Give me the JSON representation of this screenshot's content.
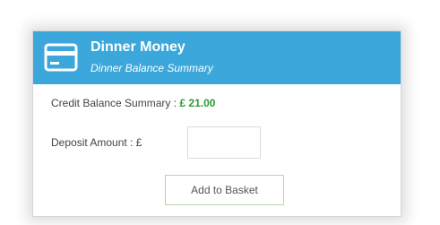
{
  "header": {
    "title": "Dinner Money",
    "subtitle": "Dinner Balance Summary",
    "icon": "credit-card-icon",
    "background_color": "#3ba7da"
  },
  "credit": {
    "label": "Credit Balance Summary :",
    "amount": "£ 21.00",
    "amount_color": "#2e9a34"
  },
  "deposit": {
    "label": "Deposit Amount : £",
    "value": ""
  },
  "actions": {
    "add_to_basket_label": "Add to Basket"
  }
}
